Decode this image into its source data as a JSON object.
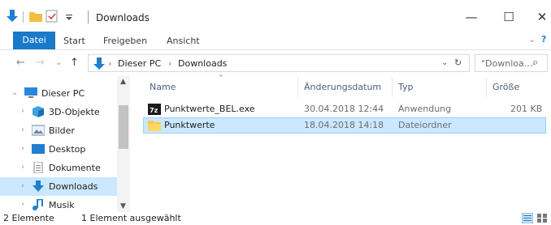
{
  "window": {
    "title": "Downloads",
    "minimize_glyph": "—",
    "maximize_glyph": "☐",
    "close_glyph": "✕"
  },
  "ribbon": {
    "tabs": [
      "Datei",
      "Start",
      "Freigeben",
      "Ansicht"
    ],
    "expand_glyph": "⌄",
    "help_glyph": "?"
  },
  "nav": {
    "back_glyph": "←",
    "forward_glyph": "→",
    "recent_glyph": "⌄",
    "up_glyph": "↑",
    "breadcrumb": [
      "Dieser PC",
      "Downloads"
    ],
    "sep_glyph": "›",
    "refresh_glyph": "↻",
    "search_placeholder": "\"Downloa...",
    "search_icon": "⌕"
  },
  "sidebar": {
    "items": [
      {
        "label": "Dieser PC",
        "icon": "computer-icon",
        "color": "#2d86d9"
      },
      {
        "label": "3D-Objekte",
        "icon": "3d-objects-icon",
        "color": "#3fa2e0"
      },
      {
        "label": "Bilder",
        "icon": "pictures-icon",
        "color": "#6c8aa8"
      },
      {
        "label": "Desktop",
        "icon": "desktop-icon",
        "color": "#1f7fd1"
      },
      {
        "label": "Dokumente",
        "icon": "documents-icon",
        "color": "#8a8a8a"
      },
      {
        "label": "Downloads",
        "icon": "downloads-icon",
        "color": "#1f7fd1"
      },
      {
        "label": "Musik",
        "icon": "music-icon",
        "color": "#1f7fd1"
      }
    ],
    "selected_index": 5
  },
  "columns": {
    "name": "Name",
    "date": "Änderungsdatum",
    "type": "Typ",
    "size": "Größe"
  },
  "files": [
    {
      "name": "Punktwerte_BEL.exe",
      "date": "30.04.2018 12:44",
      "type": "Anwendung",
      "size": "201 KB",
      "icon": "exe-icon"
    },
    {
      "name": "Punktwerte",
      "date": "18.04.2018 14:18",
      "type": "Dateiordner",
      "size": "",
      "icon": "folder-icon"
    }
  ],
  "status": {
    "count": "2 Elemente",
    "selection": "1 Element ausgewählt"
  },
  "colors": {
    "accent": "#1979ca",
    "selection_bg": "#cce8ff",
    "selection_border": "#99d1ff",
    "folder": "#f7c94b"
  }
}
